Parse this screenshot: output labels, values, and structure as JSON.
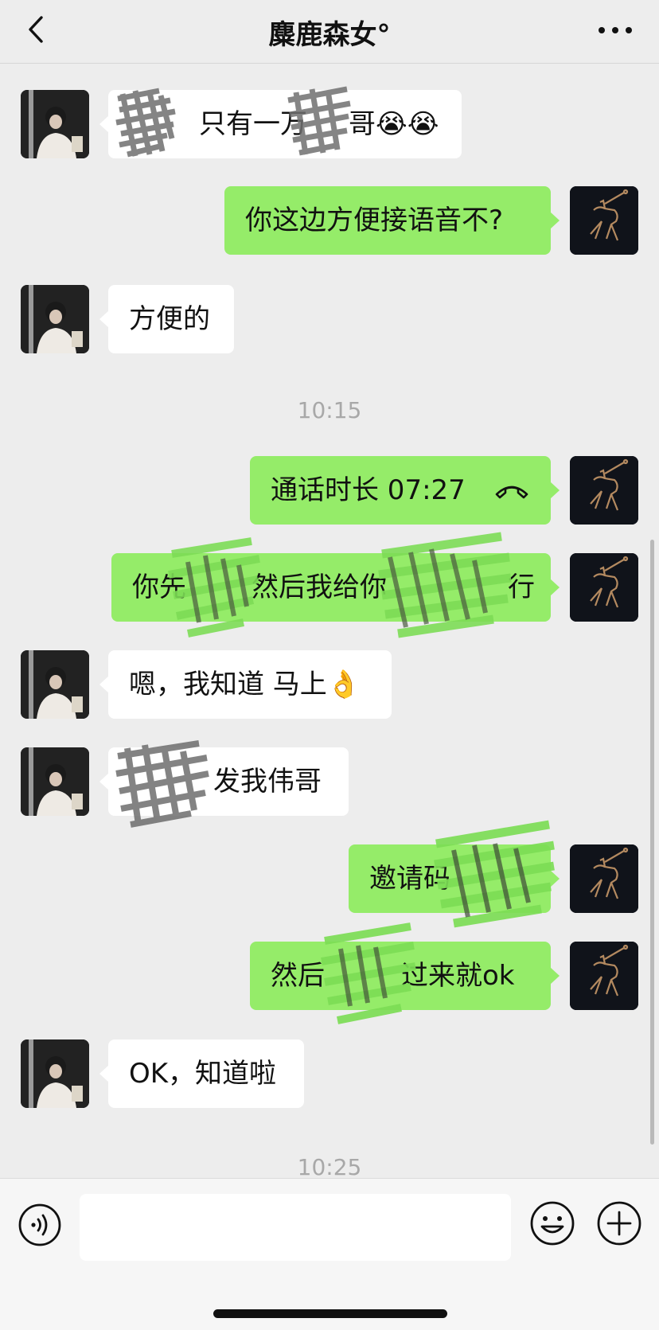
{
  "header": {
    "title": "麋鹿森女°",
    "back_icon": "chevron-left-icon",
    "more_icon": "ellipsis-icon"
  },
  "messages": [
    {
      "from": "her",
      "text": "只有一万",
      "suffix": "哥😭😭",
      "redacted": true
    },
    {
      "from": "me",
      "text": "你这边方便接语音不?"
    },
    {
      "from": "her",
      "text": "方便的"
    },
    {
      "type": "time",
      "text": "10:15"
    },
    {
      "from": "me",
      "text": "通话时长 07:27",
      "icon": "phone-hangup-icon"
    },
    {
      "from": "me",
      "text": "你先",
      "mid": "然后我给你",
      "suffix": "行",
      "redacted": true
    },
    {
      "from": "her",
      "text": "嗯，我知道 马上👌"
    },
    {
      "from": "her",
      "text": "发我伟哥",
      "redacted": true
    },
    {
      "from": "me",
      "text": "邀请码",
      "redacted": true
    },
    {
      "from": "me",
      "text": "然后",
      "suffix": "过来就ok",
      "redacted": true
    },
    {
      "from": "her",
      "text": "OK，知道啦"
    },
    {
      "type": "time",
      "text": "10:25"
    }
  ],
  "input_bar": {
    "placeholder": "",
    "voice_icon": "voice-icon",
    "emoji_icon": "smiley-icon",
    "plus_icon": "plus-icon"
  },
  "colors": {
    "bg": "#ededed",
    "out_bubble": "#95ec69",
    "in_bubble": "#ffffff",
    "timestamp": "#a8a8a8"
  }
}
